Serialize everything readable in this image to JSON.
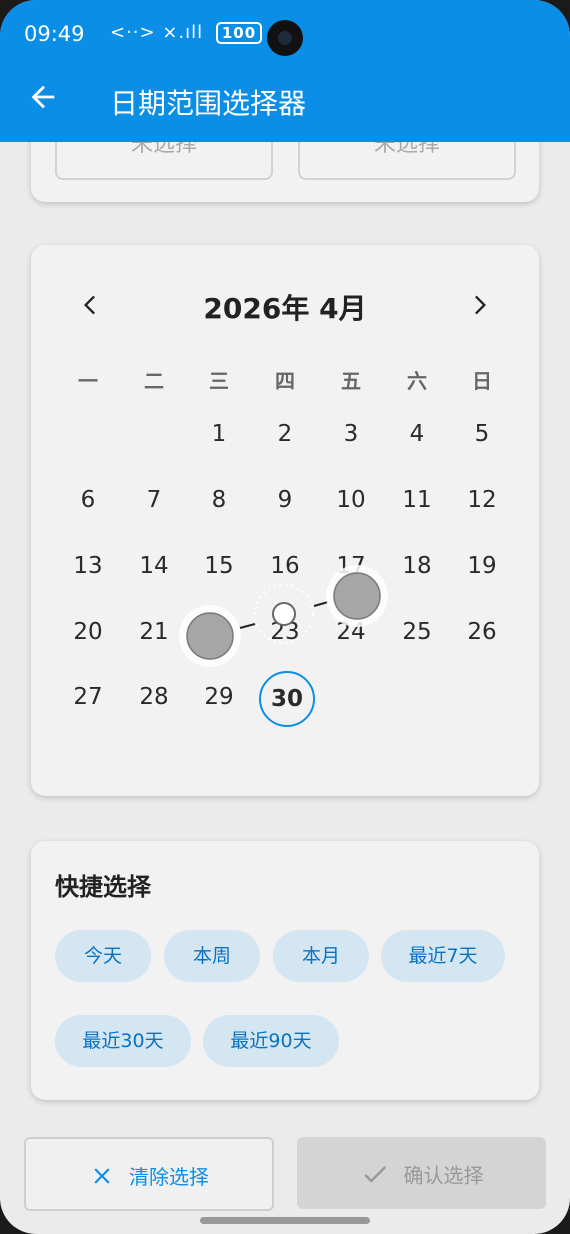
{
  "status": {
    "time": "09:49",
    "battery": "100",
    "network_icons": "<··> ×.ıll"
  },
  "appbar": {
    "title": "日期范围选择器"
  },
  "range": {
    "start_placeholder": "未选择",
    "end_placeholder": "未选择"
  },
  "calendar": {
    "month_label": "2026年 4月",
    "weekdays": [
      "一",
      "二",
      "三",
      "四",
      "五",
      "六",
      "日"
    ],
    "days": [
      "1",
      "2",
      "3",
      "4",
      "5",
      "6",
      "7",
      "8",
      "9",
      "10",
      "11",
      "12",
      "13",
      "14",
      "15",
      "16",
      "17",
      "18",
      "19",
      "20",
      "21",
      "22",
      "23",
      "24",
      "25",
      "26",
      "27",
      "28",
      "29",
      "30"
    ],
    "today_day": "30",
    "first_weekday_index": 2
  },
  "quick": {
    "title": "快捷选择",
    "chips": [
      "今天",
      "本周",
      "本月",
      "最近7天",
      "最近30天",
      "最近90天"
    ]
  },
  "actions": {
    "clear_label": "清除选择",
    "confirm_label": "确认选择"
  },
  "colors": {
    "primary": "#0a8ee6",
    "chip_bg": "#d4e6f2",
    "chip_text": "#0a72c4",
    "disabled_bg": "#d4d4d4"
  }
}
